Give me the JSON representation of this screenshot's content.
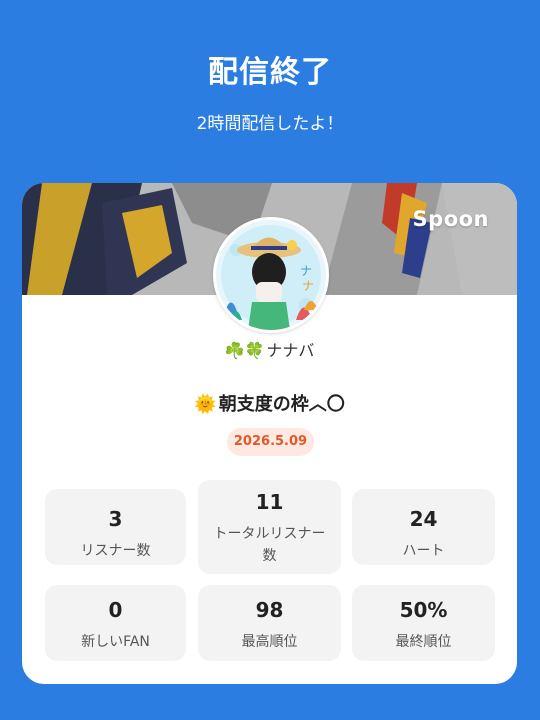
{
  "header": {
    "title": "配信終了",
    "subtitle": "2時間配信したよ！"
  },
  "card": {
    "brand": "Spoon",
    "username_prefix": "☘️🍀",
    "username": "ナナバ",
    "live_title_icon": "🌞",
    "live_title": "朝支度の枠︿〇",
    "date": "2026.5.09",
    "stats": [
      {
        "value": "3",
        "label": "リスナー数"
      },
      {
        "value": "11",
        "label": "トータルリスナー数"
      },
      {
        "value": "24",
        "label": "ハート"
      },
      {
        "value": "0",
        "label": "新しいFAN"
      },
      {
        "value": "98",
        "label": "最高順位"
      },
      {
        "value": "50%",
        "label": "最終順位"
      }
    ]
  },
  "colors": {
    "background": "#2b7de1",
    "date_text": "#e05a2b",
    "date_bg": "#fde9e2"
  }
}
